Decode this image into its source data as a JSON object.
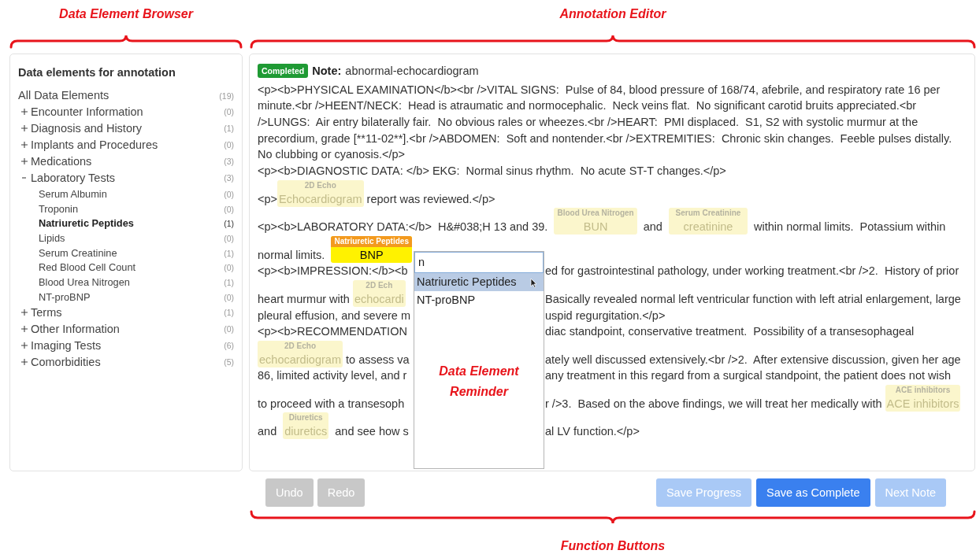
{
  "callouts": {
    "browser": "Data Element Browser",
    "editor": "Annotation Editor",
    "reminder_line1": "Data Element",
    "reminder_line2": "Reminder",
    "buttons": "Function Buttons"
  },
  "browser": {
    "title": "Data elements for annotation",
    "tree": [
      {
        "label": "All Data Elements",
        "count": "(19)",
        "selected": false,
        "children": [
          {
            "label": "Encounter Information",
            "count": "(0)",
            "selected": false,
            "expanded": false
          },
          {
            "label": "Diagnosis and History",
            "count": "(1)",
            "selected": false,
            "expanded": false
          },
          {
            "label": "Implants and Procedures",
            "count": "(0)",
            "selected": false,
            "expanded": false
          },
          {
            "label": "Medications",
            "count": "(3)",
            "selected": false,
            "expanded": false
          },
          {
            "label": "Laboratory Tests",
            "count": "(3)",
            "selected": false,
            "expanded": true,
            "children": [
              {
                "label": "Serum Albumin",
                "count": "(0)",
                "selected": false
              },
              {
                "label": "Troponin",
                "count": "(0)",
                "selected": false
              },
              {
                "label": "Natriuretic Peptides",
                "count": "(1)",
                "selected": true
              },
              {
                "label": "Lipids",
                "count": "(0)",
                "selected": false
              },
              {
                "label": "Serum Creatinine",
                "count": "(1)",
                "selected": false
              },
              {
                "label": "Red Blood Cell Count",
                "count": "(0)",
                "selected": false
              },
              {
                "label": "Blood Urea Nitrogen",
                "count": "(1)",
                "selected": false
              },
              {
                "label": "NT-proBNP",
                "count": "(0)",
                "selected": false
              }
            ]
          },
          {
            "label": "Terms",
            "count": "(1)",
            "selected": false,
            "expanded": false
          },
          {
            "label": "Other Information",
            "count": "(0)",
            "selected": false,
            "expanded": false
          },
          {
            "label": "Imaging Tests",
            "count": "(6)",
            "selected": false,
            "expanded": false
          },
          {
            "label": "Comorbidities",
            "count": "(5)",
            "selected": false,
            "expanded": false
          }
        ]
      }
    ]
  },
  "editor": {
    "status": "Completed",
    "note_label": "Note:",
    "note_name": "abnormal-echocardiogram",
    "lines": [
      {
        "segments": [
          {
            "kind": "text",
            "text": "<p><b>PHYSICAL EXAMINATION</b><br />VITAL SIGNS:  Pulse of 84, blood pressure of 168/74, afebrile, and respiratory rate 16 per"
          }
        ]
      },
      {
        "segments": [
          {
            "kind": "text",
            "text": "minute.<br />HEENT/NECK:  Head is atraumatic and normocephalic.  Neck veins flat.  No significant carotid bruits appreciated.<br"
          }
        ]
      },
      {
        "segments": [
          {
            "kind": "text",
            "text": "/>LUNGS:  Air entry bilaterally fair.  No obvious rales or wheezes.<br />HEART:  PMI displaced.  S1, S2 with systolic murmur at the"
          }
        ]
      },
      {
        "segments": [
          {
            "kind": "text",
            "text": "precordium, grade [**11-02**].<br />ABDOMEN:  Soft and nontender.<br />EXTREMITIES:  Chronic skin changes.  Feeble pulses distally."
          }
        ]
      },
      {
        "segments": [
          {
            "kind": "text",
            "text": "No clubbing or cyanosis.</p>"
          }
        ]
      },
      {
        "segments": [
          {
            "kind": "text",
            "text": "<p><b>DIAGNOSTIC DATA: </b> EKG:  Normal sinus rhythm.  No acute ST-T changes.</p>"
          }
        ]
      },
      {
        "segments": [
          {
            "kind": "text",
            "text": "<p>"
          },
          {
            "kind": "annotation",
            "label": "2D Echo",
            "text": "Echocardiogram",
            "active": false
          },
          {
            "kind": "text",
            "text": " report was reviewed.</p>"
          }
        ]
      },
      {
        "segments": [
          {
            "kind": "text",
            "text": "<p><b>LABORATORY DATA:</b>  H&#038;H 13 and 39.  "
          },
          {
            "kind": "annotation",
            "label": "Blood Urea Nitrogen",
            "text": "BUN",
            "active": false
          },
          {
            "kind": "text",
            "text": "  and  "
          },
          {
            "kind": "annotation",
            "label": "Serum Creatinine",
            "text": "creatinine",
            "active": false
          },
          {
            "kind": "text",
            "text": "  within normal limits.  Potassium within"
          }
        ]
      },
      {
        "segments": [
          {
            "kind": "text",
            "text": "normal limits.  "
          },
          {
            "kind": "annotation",
            "label": "Natriuretic Peptides",
            "text": "BNP",
            "active": true
          }
        ]
      },
      {
        "segments": [
          {
            "kind": "text",
            "text": "<p><b>IMPRESSION:</b><b"
          }
        ],
        "after_popup": [
          {
            "kind": "text",
            "text": "ed for gastrointestinal pathology, under working treatment.<br />2.  History of prior"
          }
        ]
      },
      {
        "segments": [
          {
            "kind": "text",
            "text": "heart murmur with "
          },
          {
            "kind": "annotation",
            "label": "2D Ech",
            "text": "echocardi",
            "active": false
          }
        ],
        "after_popup": [
          {
            "kind": "text",
            "text": "Basically revealed normal left ventricular function with left atrial enlargement, large"
          }
        ]
      },
      {
        "segments": [
          {
            "kind": "text",
            "text": "pleural effusion, and severe m"
          }
        ],
        "after_popup": [
          {
            "kind": "text",
            "text": "uspid regurgitation.</p>"
          }
        ]
      },
      {
        "segments": [
          {
            "kind": "text",
            "text": "<p><b>RECOMMENDATION"
          }
        ],
        "after_popup": [
          {
            "kind": "text",
            "text": "diac standpoint, conservative treatment.  Possibility of a transesophageal"
          }
        ]
      },
      {
        "segments": [
          {
            "kind": "annotation",
            "label": "2D Echo",
            "text": "echocardiogram",
            "active": false
          },
          {
            "kind": "text",
            "text": " to assess va"
          }
        ],
        "after_popup": [
          {
            "kind": "text",
            "text": "ately well discussed extensively.<br />2.  After extensive discussion, given her age"
          }
        ]
      },
      {
        "segments": [
          {
            "kind": "text",
            "text": "86, limited activity level, and r"
          }
        ],
        "after_popup": [
          {
            "kind": "text",
            "text": "any treatment in this regard from a surgical standpoint, the patient does not wish"
          }
        ]
      },
      {
        "segments": [
          {
            "kind": "text",
            "text": "to proceed with a transesoph"
          }
        ],
        "after_popup": [
          {
            "kind": "text",
            "text": "r />3.  Based on the above findings, we will treat her medically with "
          },
          {
            "kind": "annotation",
            "label": "ACE inhibitors",
            "text": "ACE inhibitors",
            "active": false
          }
        ]
      },
      {
        "segments": [
          {
            "kind": "text",
            "text": "and  "
          },
          {
            "kind": "annotation",
            "label": "Diuretics",
            "text": "diuretics",
            "active": false
          },
          {
            "kind": "text",
            "text": "  and see how s"
          }
        ],
        "after_popup": [
          {
            "kind": "text",
            "text": "al LV function.</p>"
          }
        ]
      }
    ],
    "reminder": {
      "query": "n",
      "options": [
        {
          "label": "Natriuretic Peptides",
          "selected": true
        },
        {
          "label": "NT-proBNP",
          "selected": false
        }
      ]
    }
  },
  "history_buttons": [
    {
      "label": "Undo",
      "disabled": true
    },
    {
      "label": "Redo",
      "disabled": true
    }
  ],
  "action_buttons": [
    {
      "label": "Save Progress",
      "kind": "primary",
      "disabled": true
    },
    {
      "label": "Save as Complete",
      "kind": "primary",
      "disabled": false
    },
    {
      "label": "Next Note",
      "kind": "primary",
      "disabled": true
    }
  ]
}
